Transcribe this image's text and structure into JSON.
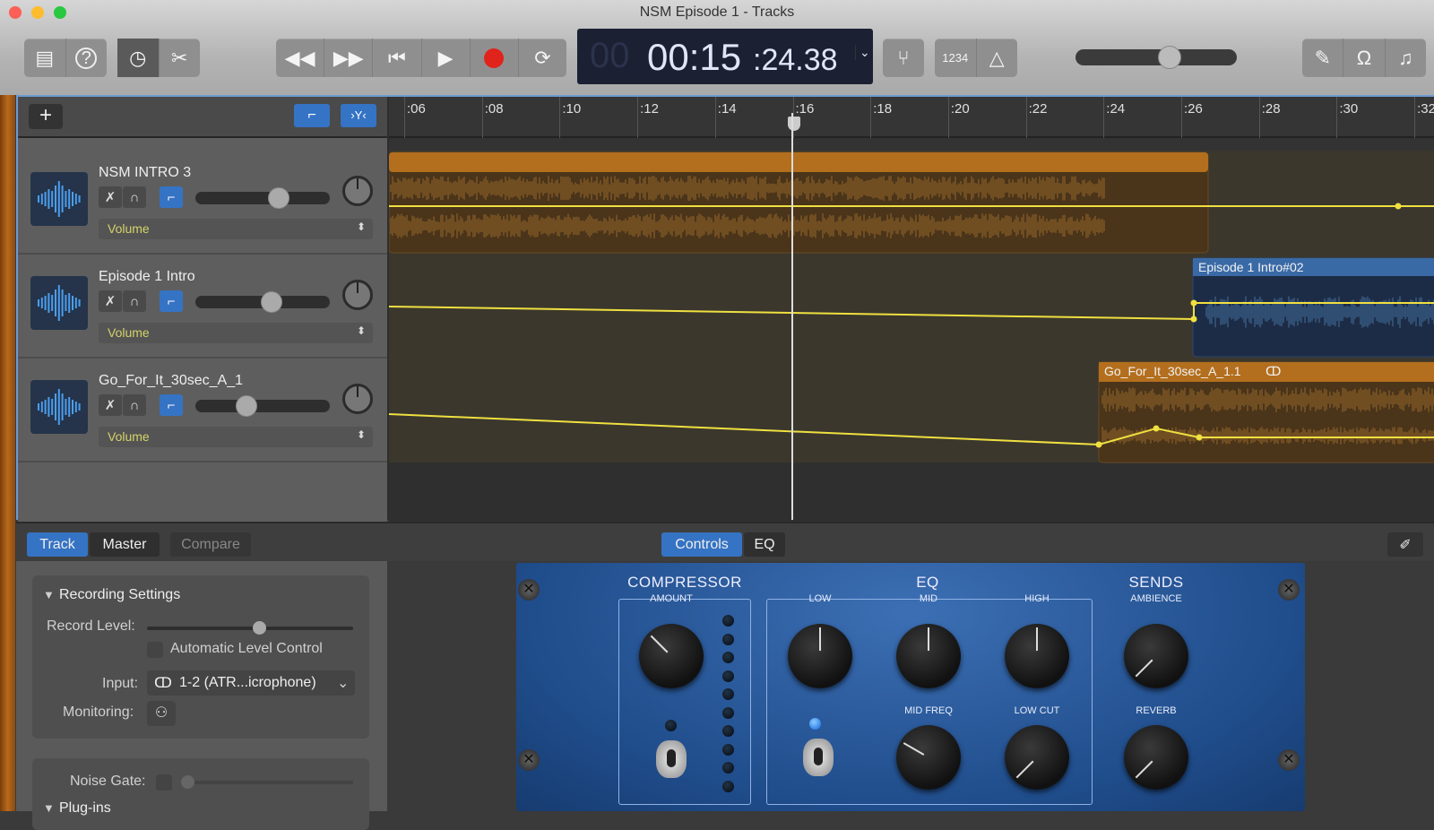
{
  "window": {
    "title": "NSM Episode 1 - Tracks"
  },
  "toolbar": {
    "lcd": {
      "dim": "00",
      "time": "00:15",
      "fraction": ":24.38"
    },
    "count_in": "1234",
    "master_volume": 0.6
  },
  "ruler": {
    "labels": [
      ":06",
      ":08",
      ":10",
      ":12",
      ":14",
      ":16",
      ":18",
      ":20",
      ":22",
      ":24",
      ":26",
      ":28",
      ":30",
      ":32"
    ]
  },
  "tracks": [
    {
      "name": "NSM INTRO 3",
      "volume": 0.64,
      "automation": "Volume"
    },
    {
      "name": "Episode 1 Intro",
      "volume": 0.58,
      "automation": "Volume"
    },
    {
      "name": "Go_For_It_30sec_A_1",
      "volume": 0.36,
      "automation": "Volume"
    }
  ],
  "regions": {
    "r2": "Episode 1 Intro#02",
    "r3": "Go_For_It_30sec_A_1.1"
  },
  "colors": {
    "audio_region": "#b36f1e",
    "voice_region": "#3a6aa6",
    "automation": "#f0e040",
    "accent": "#3573c4"
  },
  "bottom": {
    "tabs": [
      "Track",
      "Master",
      "Compare"
    ],
    "view_tabs": [
      "Controls",
      "EQ"
    ]
  },
  "recording": {
    "title": "Recording Settings",
    "record_level_label": "Record Level:",
    "record_level": 0.53,
    "alc_label": "Automatic Level Control",
    "input_label": "Input:",
    "input_value": "1-2  (ATR...icrophone)",
    "monitoring_label": "Monitoring:",
    "noise_gate_label": "Noise Gate:",
    "plugins_label": "Plug-ins"
  },
  "plugin": {
    "sections": [
      "COMPRESSOR",
      "EQ",
      "SENDS"
    ],
    "knobs": [
      {
        "label": "AMOUNT",
        "value": 0.35
      },
      {
        "label": "LOW",
        "value": 0.5
      },
      {
        "label": "MID",
        "value": 0.5
      },
      {
        "label": "HIGH",
        "value": 0.5
      },
      {
        "label": "AMBIENCE",
        "value": 0.05
      },
      {
        "label": "MID FREQ",
        "value": 0.3
      },
      {
        "label": "LOW CUT",
        "value": 0.05
      },
      {
        "label": "REVERB",
        "value": 0.05
      }
    ]
  }
}
